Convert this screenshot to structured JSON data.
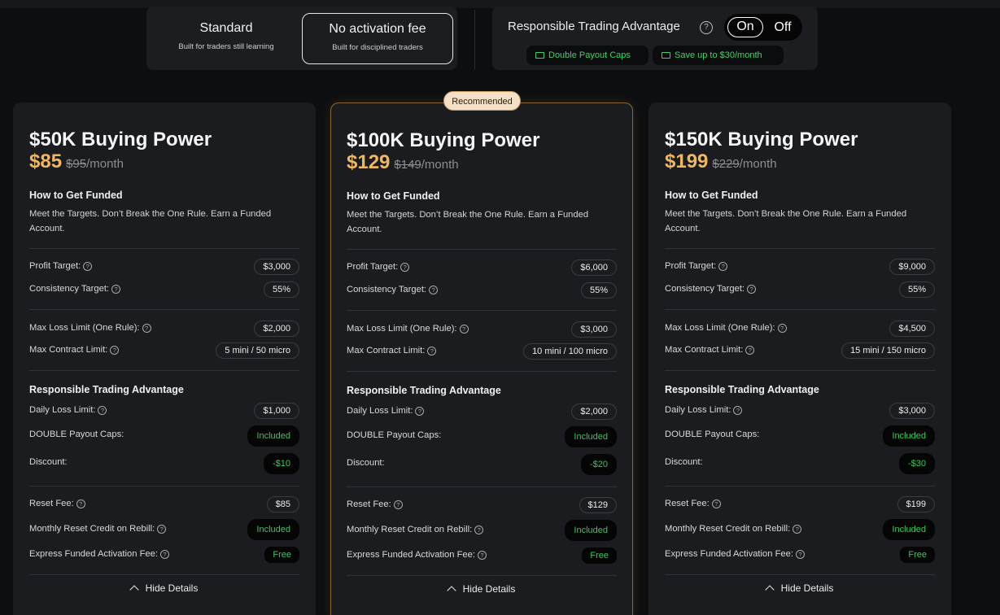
{
  "plan_toggle": {
    "standard": {
      "title": "Standard",
      "subtitle": "Built for traders still learning"
    },
    "no_fee": {
      "title": "No activation fee",
      "subtitle": "Built for disciplined traders"
    }
  },
  "rta_toggle": {
    "title": "Responsible Trading Advantage",
    "on_label": "On",
    "off_label": "Off",
    "pills": [
      "Double Payout Caps",
      "Save up to $30/month"
    ]
  },
  "recommended_badge": "Recommended",
  "labels": {
    "how_to_get_funded": "How to Get Funded",
    "description": "Meet the Targets. Don’t Break the One Rule. Earn a Funded Account.",
    "profit_target": "Profit Target:",
    "consistency_target": "Consistency Target:",
    "max_loss_limit": "Max Loss Limit (One Rule):",
    "max_contract_limit": "Max Contract Limit:",
    "rta_section": "Responsible Trading Advantage",
    "daily_loss_limit": "Daily Loss Limit:",
    "double_payout_caps": "DOUBLE Payout Caps:",
    "discount": "Discount:",
    "reset_fee": "Reset Fee:",
    "monthly_reset_credit": "Monthly Reset Credit on Rebill:",
    "express_activation_fee": "Express Funded Activation Fee:",
    "hide_details": "Hide Details",
    "per_month": "/month",
    "help_glyph": "?"
  },
  "cards": [
    {
      "title": "$50K Buying Power",
      "price": "$85",
      "old_price": "$95",
      "profit_target": "$3,000",
      "consistency_target": "55%",
      "max_loss_limit": "$2,000",
      "max_contract_limit": "5 mini / 50 micro",
      "daily_loss_limit": "$1,000",
      "double_payout_caps": "Included",
      "discount": "-$10",
      "reset_fee": "$85",
      "monthly_reset_credit": "Included",
      "express_activation_fee": "Free"
    },
    {
      "title": "$100K Buying Power",
      "price": "$129",
      "old_price": "$149",
      "profit_target": "$6,000",
      "consistency_target": "55%",
      "max_loss_limit": "$3,000",
      "max_contract_limit": "10 mini / 100 micro",
      "daily_loss_limit": "$2,000",
      "double_payout_caps": "Included",
      "discount": "-$20",
      "reset_fee": "$129",
      "monthly_reset_credit": "Included",
      "express_activation_fee": "Free"
    },
    {
      "title": "$150K Buying Power",
      "price": "$199",
      "old_price": "$229",
      "profit_target": "$9,000",
      "consistency_target": "55%",
      "max_loss_limit": "$4,500",
      "max_contract_limit": "15 mini / 150 micro",
      "daily_loss_limit": "$3,000",
      "double_payout_caps": "Included",
      "discount": "-$30",
      "reset_fee": "$199",
      "monthly_reset_credit": "Included",
      "express_activation_fee": "Free"
    }
  ]
}
